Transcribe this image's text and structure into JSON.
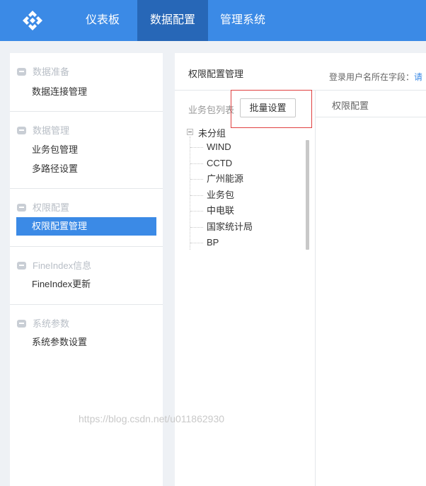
{
  "topbar": {
    "logo_icon": "diamond-logo-icon",
    "nav": [
      {
        "label": "仪表板",
        "active": false
      },
      {
        "label": "数据配置",
        "active": true
      },
      {
        "label": "管理系统",
        "active": false
      }
    ]
  },
  "sidebar": {
    "sections": [
      {
        "title": "数据准备",
        "icon": "folder-icon",
        "items": [
          {
            "label": "数据连接管理",
            "active": false
          }
        ]
      },
      {
        "title": "数据管理",
        "icon": "folder-icon",
        "items": [
          {
            "label": "业务包管理",
            "active": false
          },
          {
            "label": "多路径设置",
            "active": false
          }
        ]
      },
      {
        "title": "权限配置",
        "icon": "folder-icon",
        "items": [
          {
            "label": "权限配置管理",
            "active": true
          }
        ]
      },
      {
        "title": "FineIndex信息",
        "icon": "folder-icon",
        "items": [
          {
            "label": "FineIndex更新",
            "active": false
          }
        ]
      },
      {
        "title": "系统参数",
        "icon": "folder-icon",
        "items": [
          {
            "label": "系统参数设置",
            "active": false
          }
        ]
      }
    ]
  },
  "main": {
    "title": "权限配置管理",
    "login_hint": "登录用户名所在字段：",
    "login_link": "请",
    "list_label": "业务包列表",
    "batch_button": "批量设置",
    "permission_header": "权限配置",
    "tree": {
      "group": "未分组",
      "nodes": [
        "WIND",
        "CCTD",
        "广州能源",
        "业务包",
        "中电联",
        "国家统计局",
        "BP"
      ]
    }
  },
  "watermark": "https://blog.csdn.net/u011862930",
  "colors": {
    "primary": "#3b8ae6",
    "primary_dark": "#2767b7",
    "highlight_border": "#e04040"
  }
}
